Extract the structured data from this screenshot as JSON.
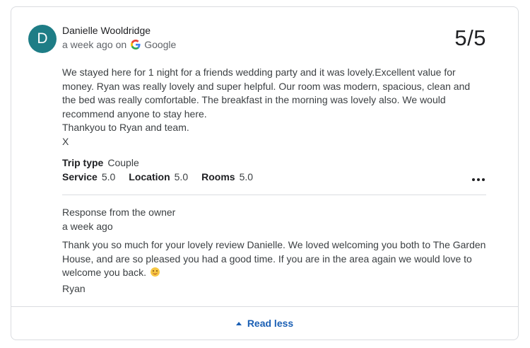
{
  "review": {
    "avatar_letter": "D",
    "author": "Danielle Wooldridge",
    "time": "a week ago",
    "on_label": "on",
    "source": "Google",
    "rating": "5/5",
    "text_lines": [
      "We stayed here for 1 night for a friends wedding party and it was lovely.Excellent value for money. Ryan was really lovely and super helpful. Our room was modern, spacious, clean and the bed was really comfortable. The breakfast in the morning was lovely also. We would recommend anyone to stay here.",
      "Thankyou to Ryan and team.",
      "X"
    ],
    "trip_type_label": "Trip type",
    "trip_type_value": "Couple",
    "sub_ratings": [
      {
        "label": "Service",
        "value": "5.0"
      },
      {
        "label": "Location",
        "value": "5.0"
      },
      {
        "label": "Rooms",
        "value": "5.0"
      }
    ]
  },
  "owner_response": {
    "title": "Response from the owner",
    "time": "a week ago",
    "text": "Thank you so much for your lovely review Danielle. We loved welcoming you both to The Garden House, and are so pleased you had a good time. If you are in the area again we would love to welcome you back.",
    "emoji": "smiling-face-emoji",
    "signature": "Ryan"
  },
  "footer": {
    "read_less_label": "Read less"
  },
  "colors": {
    "avatar_bg": "#1e7d86",
    "link": "#1a5fb4",
    "border": "#dadce0"
  }
}
